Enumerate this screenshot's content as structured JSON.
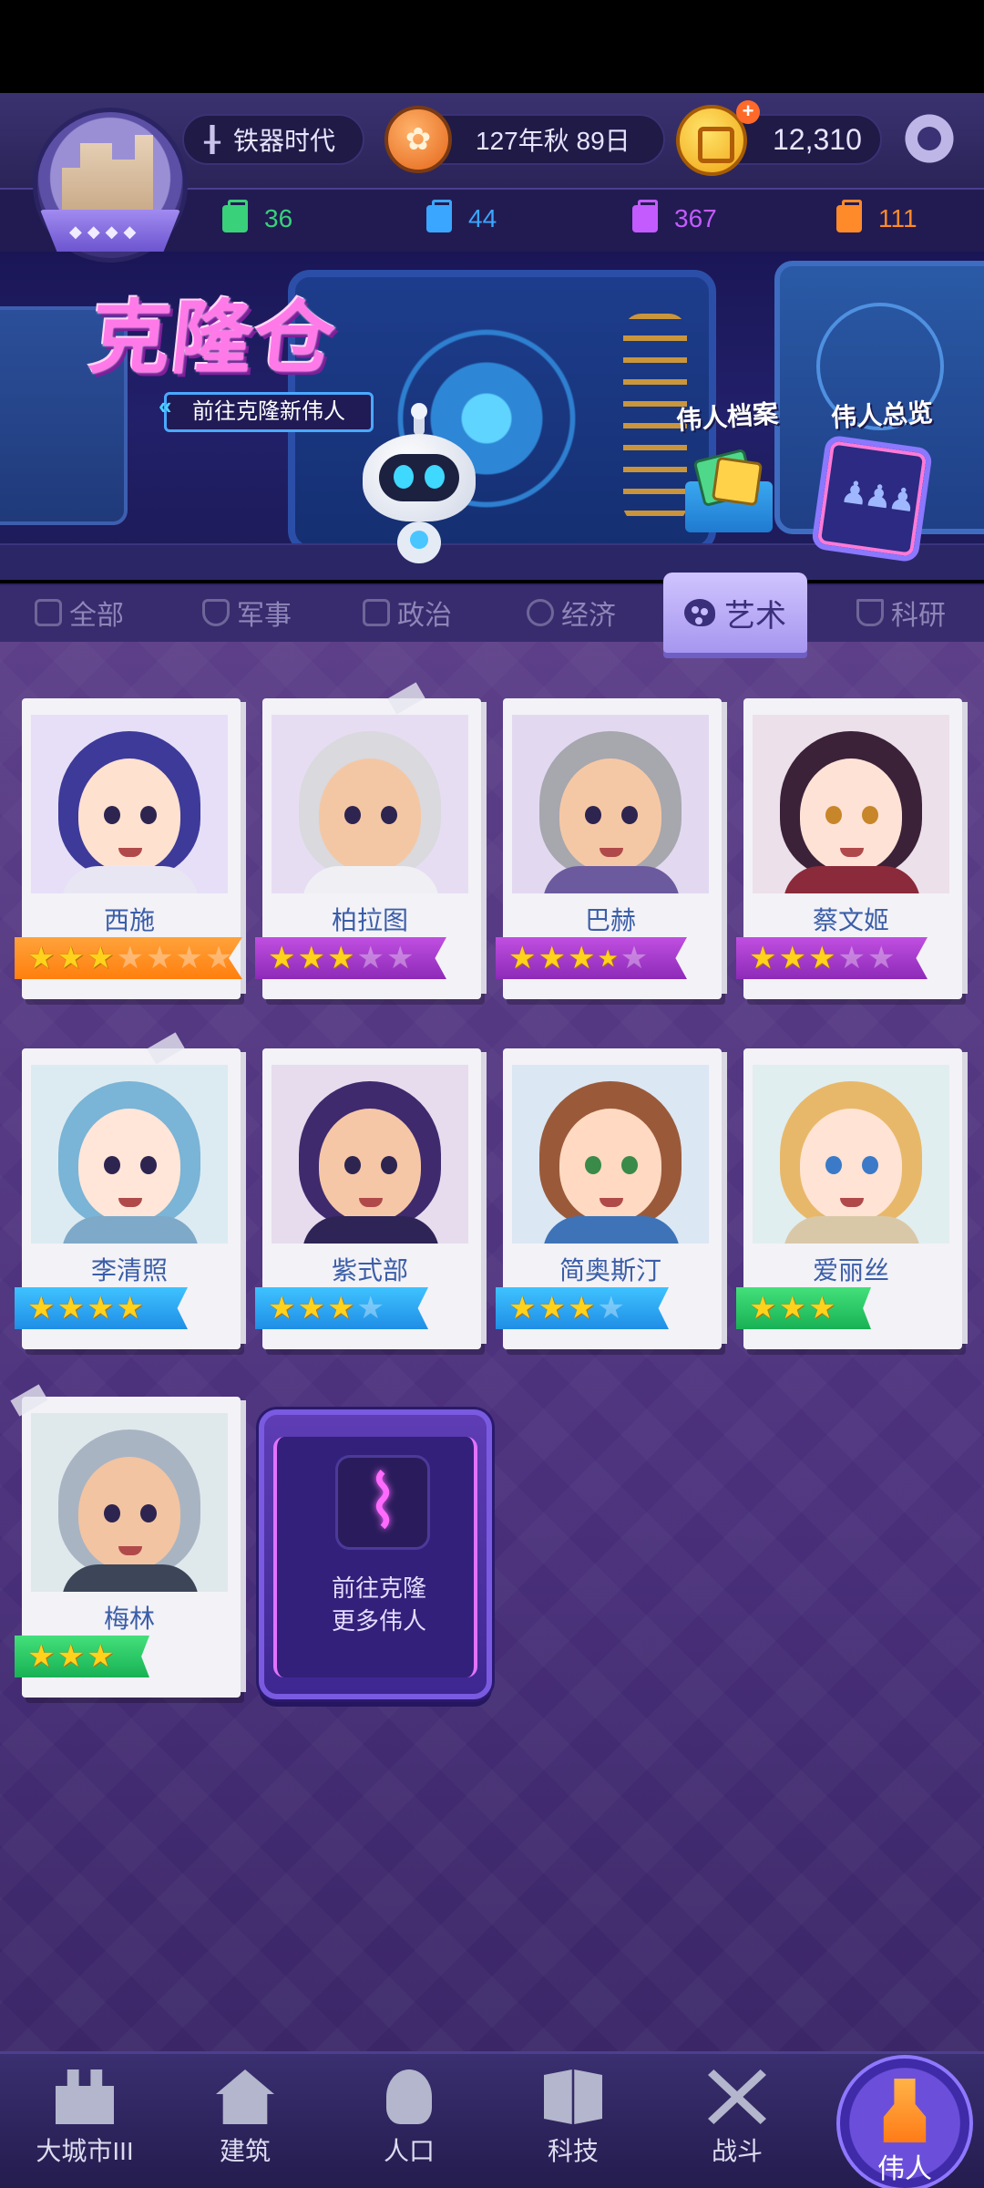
{
  "header": {
    "era": "铁器时代",
    "date": "127年秋 89日",
    "coins": "12,310"
  },
  "resources": [
    {
      "value": "36",
      "color": "#39d17a"
    },
    {
      "value": "44",
      "color": "#3aa6ff"
    },
    {
      "value": "367",
      "color": "#c45bff"
    },
    {
      "value": "111",
      "color": "#ff8a2a"
    }
  ],
  "banner": {
    "title": "克隆仓",
    "subtitle": "前往克隆新伟人",
    "archive_label": "伟人档案",
    "overview_label": "伟人总览"
  },
  "tabs": [
    {
      "label": "全部",
      "icon": "grid-icon"
    },
    {
      "label": "军事",
      "icon": "shield-icon"
    },
    {
      "label": "政治",
      "icon": "capitol-icon"
    },
    {
      "label": "经济",
      "icon": "coins-icon"
    },
    {
      "label": "艺术",
      "icon": "palette-icon",
      "active": true
    },
    {
      "label": "科研",
      "icon": "flask-icon"
    }
  ],
  "heroes": [
    {
      "name": "西施",
      "stars": 3,
      "max_stars": 7,
      "ribbon": "orange"
    },
    {
      "name": "柏拉图",
      "stars": 3,
      "max_stars": 5,
      "ribbon": "purple"
    },
    {
      "name": "巴赫",
      "stars": 3.5,
      "max_stars": 5,
      "ribbon": "purple"
    },
    {
      "name": "蔡文姬",
      "stars": 3,
      "max_stars": 5,
      "ribbon": "purple"
    },
    {
      "name": "李清照",
      "stars": 4,
      "max_stars": 4,
      "ribbon": "blue"
    },
    {
      "name": "紫式部",
      "stars": 3,
      "max_stars": 4,
      "ribbon": "blue"
    },
    {
      "name": "简奥斯汀",
      "stars": 3,
      "max_stars": 4,
      "ribbon": "blue"
    },
    {
      "name": "爱丽丝",
      "stars": 3,
      "max_stars": 3,
      "ribbon": "green"
    },
    {
      "name": "梅林",
      "stars": 3,
      "max_stars": 3,
      "ribbon": "green"
    }
  ],
  "clone_card": {
    "line1": "前往克隆",
    "line2": "更多伟人"
  },
  "nav": [
    {
      "label": "大城市III",
      "icon": "castle-icon"
    },
    {
      "label": "建筑",
      "icon": "house-icon"
    },
    {
      "label": "人口",
      "icon": "person-icon"
    },
    {
      "label": "科技",
      "icon": "book-icon"
    },
    {
      "label": "战斗",
      "icon": "crossed-swords-icon"
    },
    {
      "label": "伟人",
      "icon": "statue-icon",
      "active": true
    }
  ]
}
